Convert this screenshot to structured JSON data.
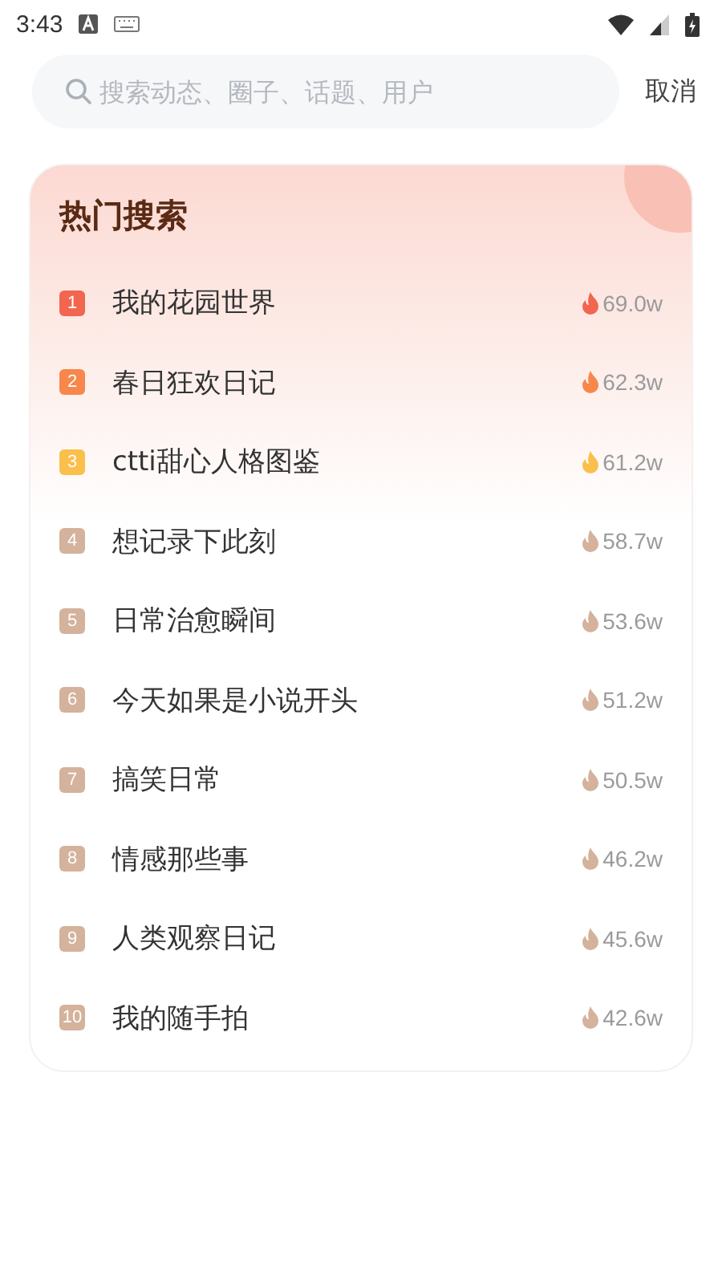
{
  "status_bar": {
    "time": "3:43"
  },
  "search": {
    "placeholder": "搜索动态、圈子、话题、用户",
    "cancel": "取消"
  },
  "hot_search": {
    "title": "热门搜索",
    "items": [
      {
        "rank": "1",
        "label": "我的花园世界",
        "count": "69.0w",
        "color": "#f2654f"
      },
      {
        "rank": "2",
        "label": "春日狂欢日记",
        "count": "62.3w",
        "color": "#f7874a"
      },
      {
        "rank": "3",
        "label": "ctti甜心人格图鉴",
        "count": "61.2w",
        "color": "#fbbf4c"
      },
      {
        "rank": "4",
        "label": "想记录下此刻",
        "count": "58.7w",
        "color": "#d4b29c"
      },
      {
        "rank": "5",
        "label": "日常治愈瞬间",
        "count": "53.6w",
        "color": "#d4b29c"
      },
      {
        "rank": "6",
        "label": "今天如果是小说开头",
        "count": "51.2w",
        "color": "#d4b29c"
      },
      {
        "rank": "7",
        "label": "搞笑日常",
        "count": "50.5w",
        "color": "#d4b29c"
      },
      {
        "rank": "8",
        "label": "情感那些事",
        "count": "46.2w",
        "color": "#d4b29c"
      },
      {
        "rank": "9",
        "label": "人类观察日记",
        "count": "45.6w",
        "color": "#d4b29c"
      },
      {
        "rank": "10",
        "label": "我的随手拍",
        "count": "42.6w",
        "color": "#d4b29c"
      }
    ]
  }
}
